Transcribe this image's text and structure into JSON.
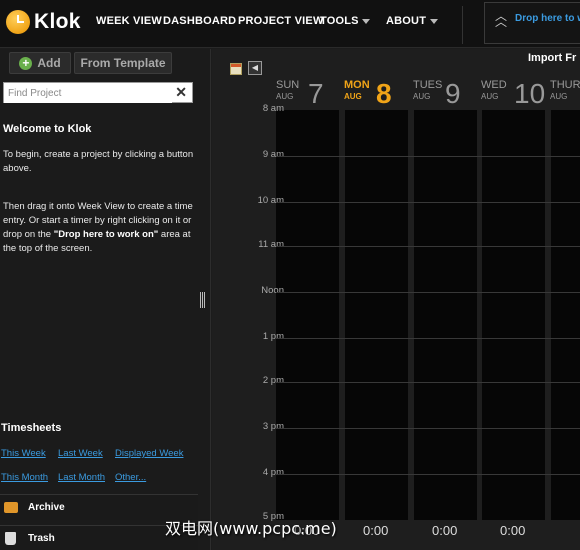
{
  "app": {
    "name": "Klok"
  },
  "nav": {
    "week_view": "WEEK VIEW",
    "dashboard": "DASHBOARD",
    "project_view": "PROJECT VIEW",
    "tools": "TOOLS",
    "about": "ABOUT"
  },
  "drop_zone": {
    "text": "Drop here to w"
  },
  "sidebar": {
    "add_label": "Add",
    "template_label": "From Template",
    "search_placeholder": "Find Project",
    "welcome_title": "Welcome to Klok",
    "para1": "To begin, create a project by clicking a button above.",
    "para2_a": "Then drag it onto Week View to create a time entry. Or start a timer by right clicking on it or drop on the ",
    "para2_b": "\"Drop here to work on\"",
    "para2_c": " area at the top of the screen.",
    "timesheets_title": "Timesheets",
    "links": {
      "this_week": "This Week",
      "last_week": "Last Week",
      "displayed_week": "Displayed Week",
      "this_month": "This Month",
      "last_month": "Last Month",
      "other": "Other..."
    },
    "archive_label": "Archive",
    "trash_label": "Trash"
  },
  "calendar": {
    "import_label": "Import Fr",
    "days": [
      {
        "name": "SUN",
        "month": "AUG",
        "num": "7"
      },
      {
        "name": "MON",
        "month": "AUG",
        "num": "8"
      },
      {
        "name": "TUES",
        "month": "AUG",
        "num": "9"
      },
      {
        "name": "WED",
        "month": "AUG",
        "num": "10"
      },
      {
        "name": "THUR",
        "month": "AUG",
        "num": ""
      }
    ],
    "today_index": 1,
    "hours": [
      "8 am",
      "9 am",
      "10 am",
      "11 am",
      "Noon",
      "1 pm",
      "2 pm",
      "3 pm",
      "4 pm",
      "5 pm"
    ],
    "totals": [
      "0:00",
      "0:00",
      "0:00",
      "0:00"
    ]
  },
  "watermark": "双电网(www.pcpc.me)",
  "colors": {
    "accent": "#f0a418",
    "link": "#3b9be0"
  }
}
